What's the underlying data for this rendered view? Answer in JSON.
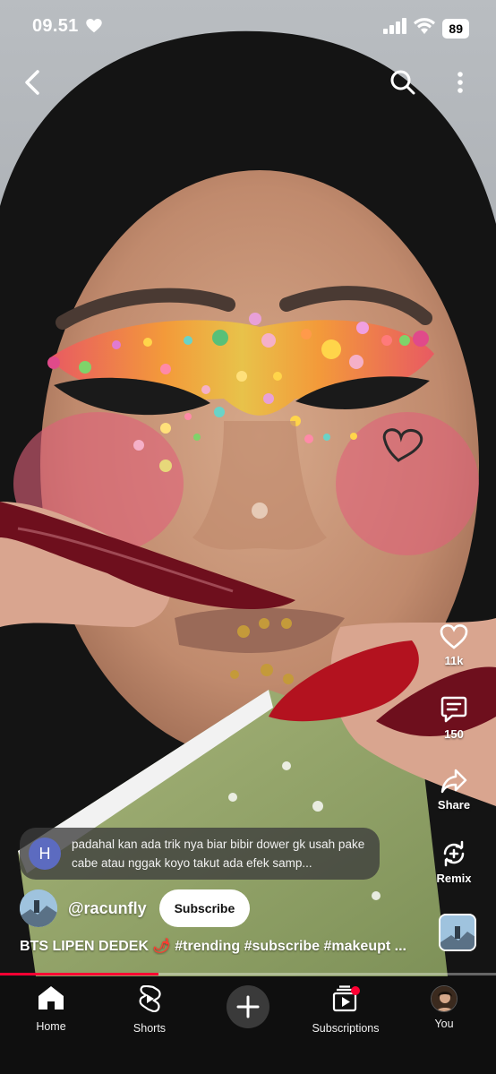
{
  "status_bar": {
    "time": "09.51",
    "battery": "89"
  },
  "top_actions": {
    "back_icon": "chevron-left-icon",
    "search_icon": "search-icon",
    "more_icon": "more-vert-icon"
  },
  "actions": {
    "like_count": "11k",
    "comment_count": "150",
    "share_label": "Share",
    "remix_label": "Remix"
  },
  "comment": {
    "avatar_letter": "H",
    "text": "padahal kan ada trik nya biar bibir dower gk usah pake cabe atau nggak koyo takut ada efek samp..."
  },
  "channel": {
    "name": "@racunfly",
    "subscribe_label": "Subscribe"
  },
  "caption": {
    "title": "BTS LIPEN DEDEK",
    "emoji": "🌶",
    "hashtags": "#trending #subscribe #makeupt ..."
  },
  "progress": {
    "played_fraction": 0.32
  },
  "nav": {
    "home": "Home",
    "shorts": "Shorts",
    "subscriptions": "Subscriptions",
    "you": "You"
  },
  "colors": {
    "accent_red": "#ff0033",
    "nav_background": "#0f0f0f"
  }
}
